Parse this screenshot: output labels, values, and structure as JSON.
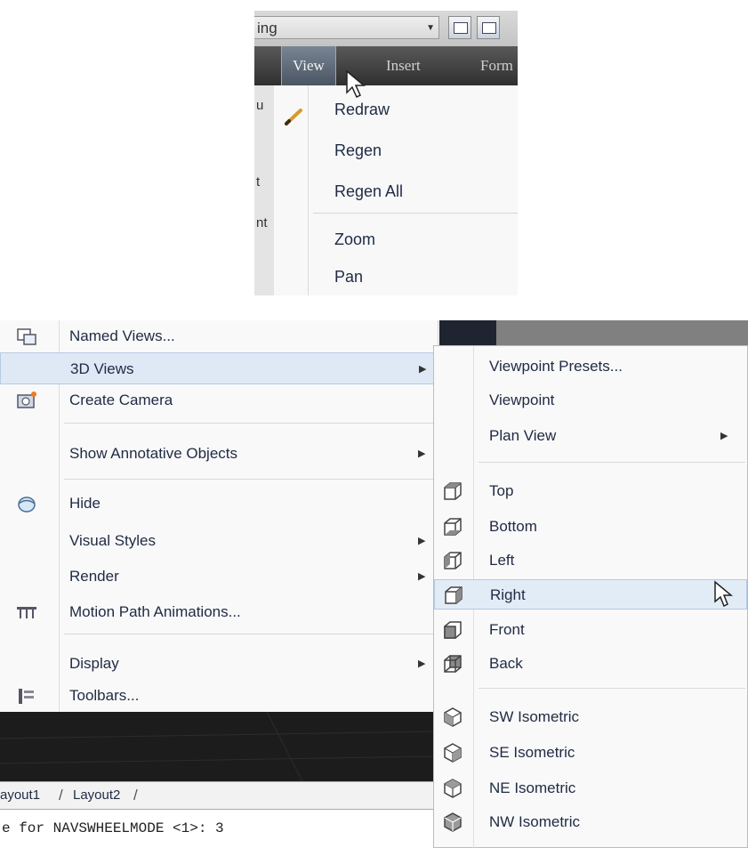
{
  "toolbar": {
    "workspace_combo_value": "ing",
    "icons": [
      "combo-arrow-icon",
      "toolbar-button-icon",
      "toolbar-button-icon"
    ]
  },
  "menubar": {
    "items": [
      "View",
      "Insert",
      "Form"
    ]
  },
  "left_strip": {
    "fragments": [
      "u",
      "t",
      "nt"
    ]
  },
  "view_menu_top": {
    "items": [
      {
        "label": "Redraw",
        "icon": "redraw-pencil-icon"
      },
      {
        "label": "Regen"
      },
      {
        "label": "Regen All"
      },
      {
        "label": "Zoom"
      },
      {
        "label": "Pan"
      }
    ]
  },
  "view_menu": {
    "items": [
      {
        "label": "Named Views...",
        "icon": "named-views-icon"
      },
      {
        "label": "3D Views",
        "has_submenu": true,
        "highlighted": true
      },
      {
        "label": "Create Camera",
        "icon": "camera-icon"
      },
      {
        "label": "Show Annotative Objects",
        "has_submenu": true
      },
      {
        "label": "Hide",
        "icon": "hide-icon"
      },
      {
        "label": "Visual Styles",
        "has_submenu": true
      },
      {
        "label": "Render",
        "has_submenu": true
      },
      {
        "label": "Motion Path Animations...",
        "icon": "motion-path-icon"
      },
      {
        "label": "Display",
        "has_submenu": true
      },
      {
        "label": "Toolbars...",
        "icon": "toolbars-icon"
      }
    ]
  },
  "submenu_3d_views": {
    "items": [
      {
        "label": "Viewpoint Presets..."
      },
      {
        "label": "Viewpoint"
      },
      {
        "label": "Plan View",
        "has_submenu": true
      },
      {
        "label": "Top",
        "icon": "top-view-icon"
      },
      {
        "label": "Bottom",
        "icon": "bottom-view-icon"
      },
      {
        "label": "Left",
        "icon": "left-view-icon"
      },
      {
        "label": "Right",
        "icon": "right-view-icon",
        "highlighted": true
      },
      {
        "label": "Front",
        "icon": "front-view-icon"
      },
      {
        "label": "Back",
        "icon": "back-view-icon"
      },
      {
        "label": "SW Isometric",
        "icon": "sw-isometric-icon"
      },
      {
        "label": "SE Isometric",
        "icon": "se-isometric-icon"
      },
      {
        "label": "NE Isometric",
        "icon": "ne-isometric-icon"
      },
      {
        "label": "NW Isometric",
        "icon": "nw-isometric-icon"
      }
    ]
  },
  "layout_tabs": [
    "ayout1",
    "Layout2"
  ],
  "command_line": {
    "text": "e for NAVSWHEELMODE <1>: 3"
  },
  "colors": {
    "menu_highlight": "#dfe9f5",
    "menubar_dark": "#3a3a3a",
    "drawing_background": "#1c1c1c"
  }
}
